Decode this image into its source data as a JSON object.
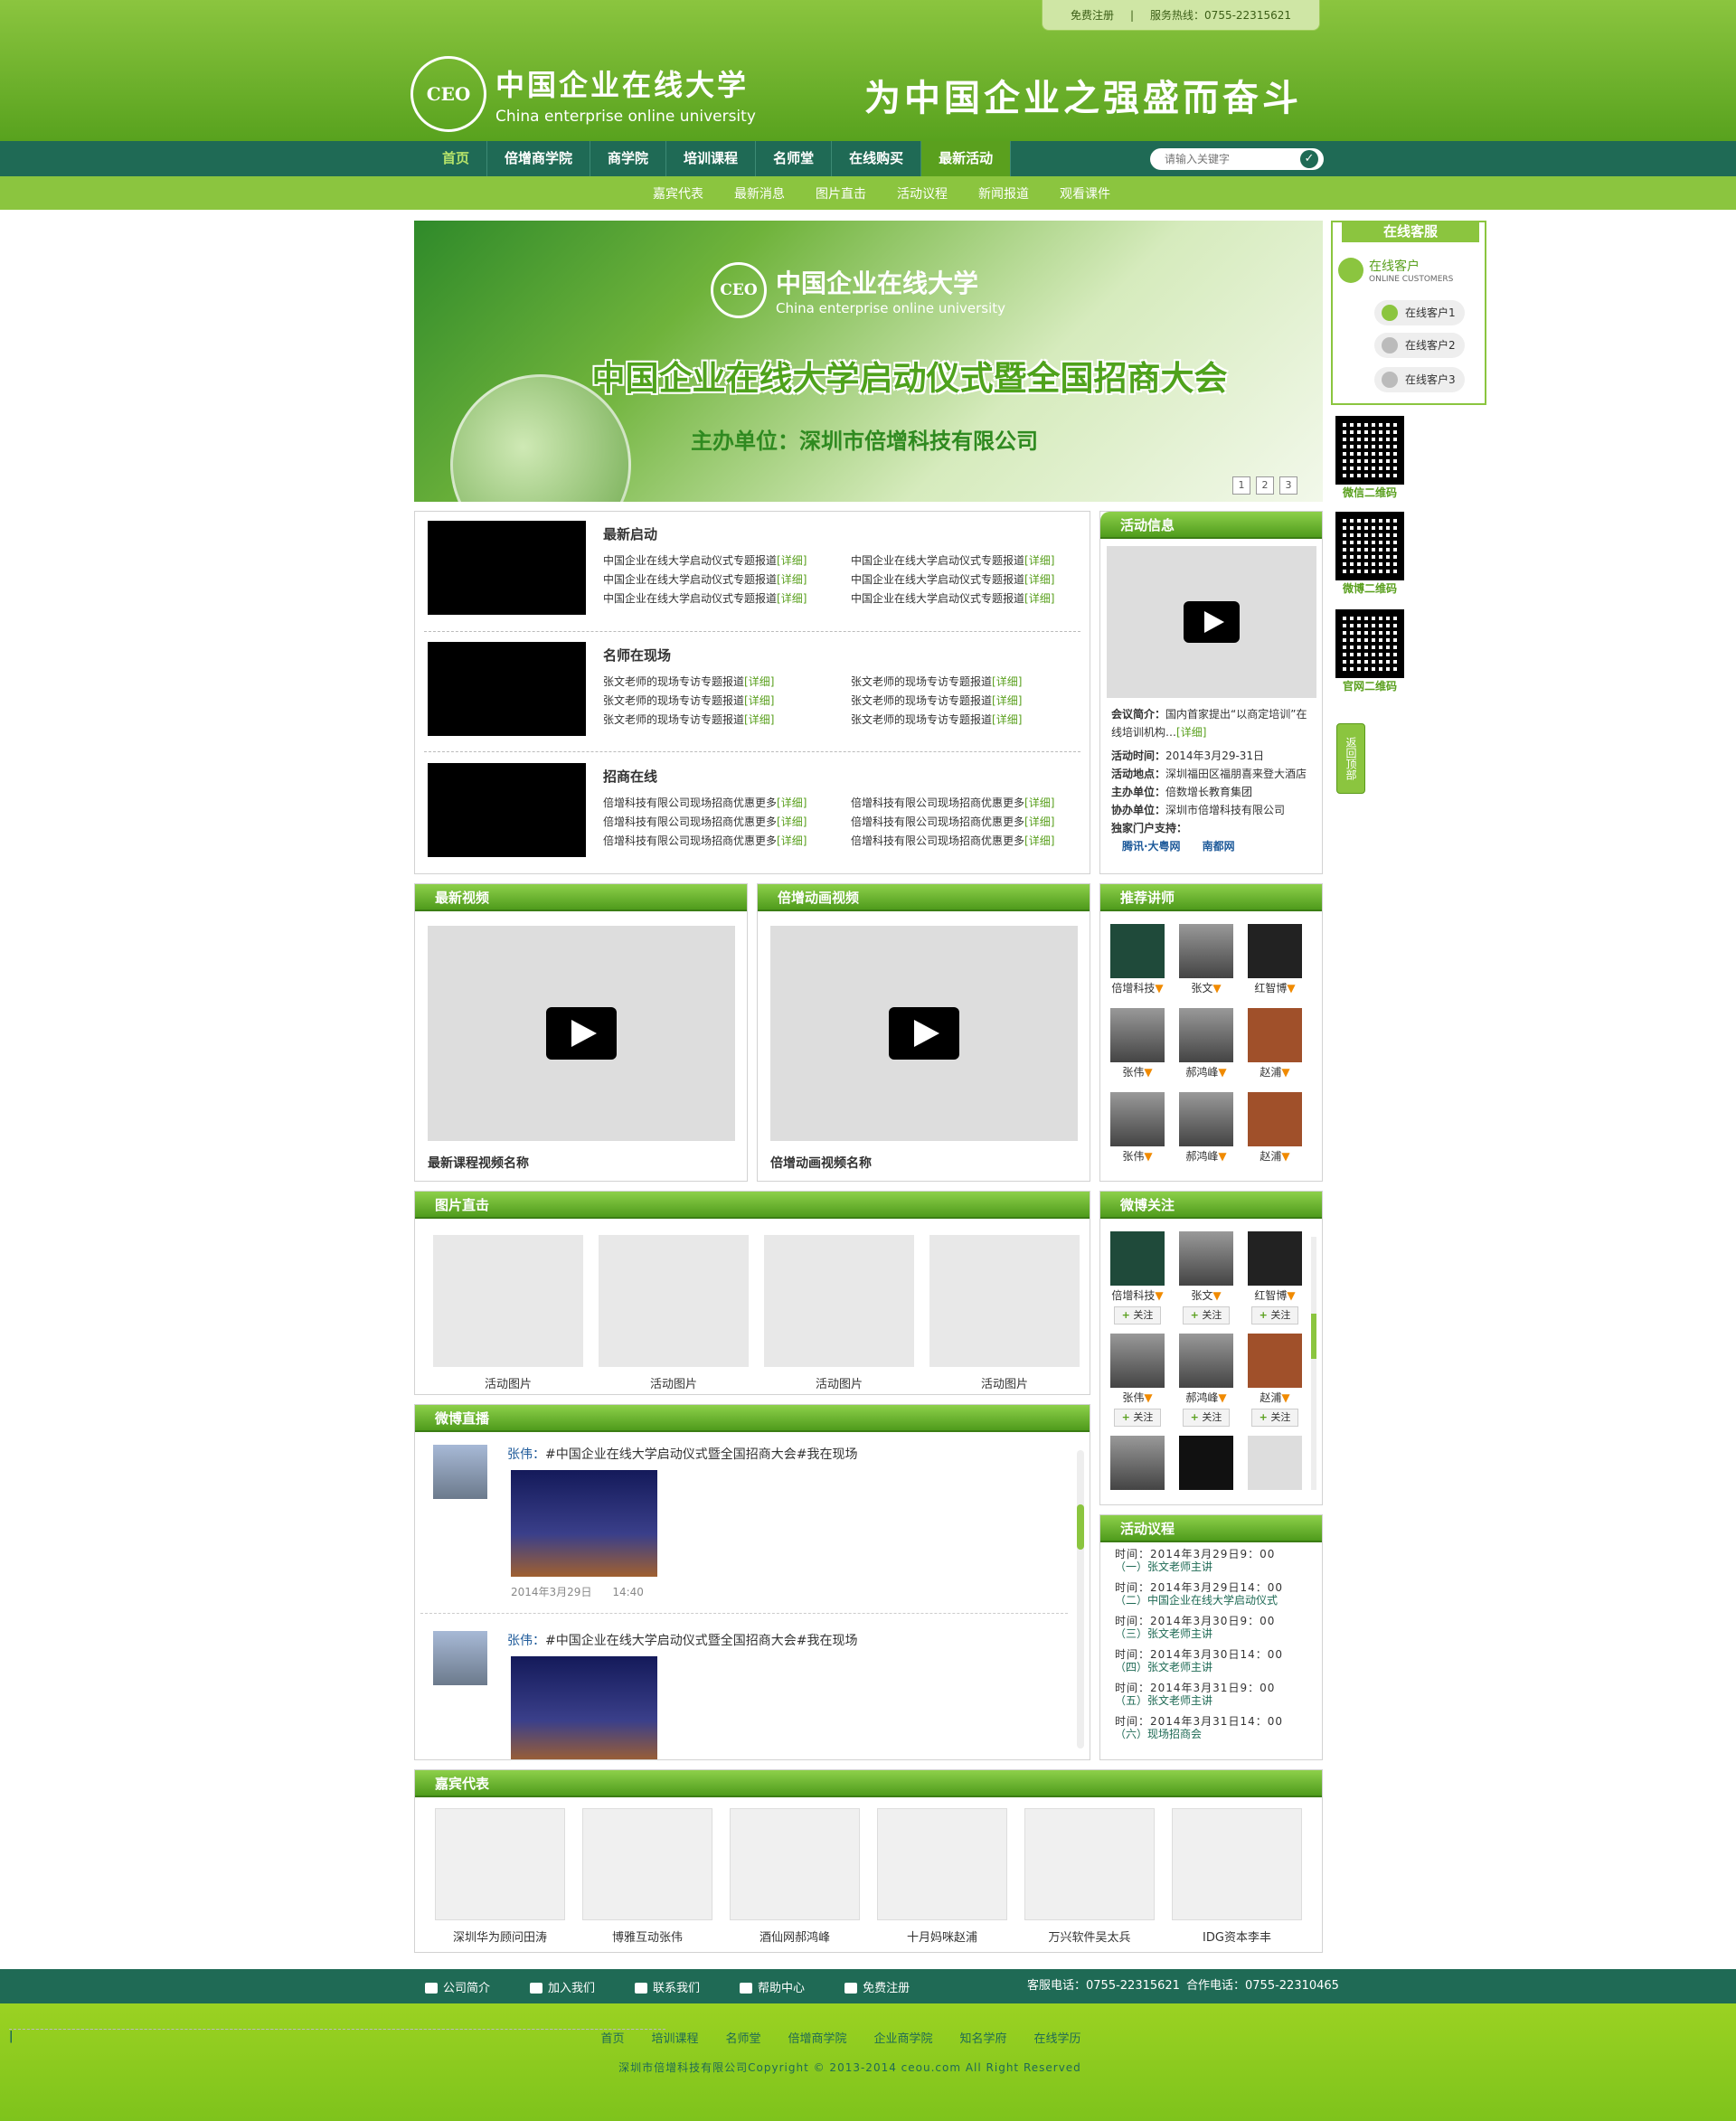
{
  "topbar": {
    "register": "免费注册",
    "hotline": "服务热线：0755-22315621"
  },
  "logo": {
    "badge": "CEO",
    "cn": "中国企业在线大学",
    "en": "China enterprise online university"
  },
  "slogan": "为中国企业之强盛而奋斗",
  "nav": {
    "items": [
      "首页",
      "倍增商学院",
      "商学院",
      "培训课程",
      "名师堂",
      "在线购买",
      "最新活动"
    ],
    "search_placeholder": "请输入关键字"
  },
  "subnav": [
    "嘉宾代表",
    "最新消息",
    "图片直击",
    "活动议程",
    "新闻报道",
    "观看课件"
  ],
  "banner": {
    "badge": "CEO",
    "cn": "中国企业在线大学",
    "en": "China enterprise online university",
    "title": "中国企业在线大学启动仪式暨全国招商大会",
    "sub": "主办单位：深圳市倍增科技有限公司",
    "pages": [
      "1",
      "2",
      "3"
    ]
  },
  "news": {
    "rows": [
      {
        "title": "最新启动",
        "item": "中国企业在线大学启动仪式专题报道",
        "more": "[详细]"
      },
      {
        "title": "名师在现场",
        "item": "张文老师的现场专访专题报道",
        "more": "[详细]"
      },
      {
        "title": "招商在线",
        "item": "倍增科技有限公司现场招商优惠更多",
        "more": "[详细]"
      }
    ]
  },
  "events": {
    "header": "活动信息",
    "intro_label": "会议简介：",
    "intro": "国内首家提出“以商定培训”在线培训机构…",
    "intro_more": "[详细]",
    "time_label": "活动时间：",
    "time": "2014年3月29-31日",
    "place_label": "活动地点：",
    "place": "深圳福田区福朋喜来登大酒店",
    "host_label": "主办单位：",
    "host": "倍数增长教育集团",
    "co_label": "协办单位：",
    "co": "深圳市倍增科技有限公司",
    "portal_label": "独家门户支持：",
    "portal1": "腾讯·大粤网",
    "portal2": "南都网"
  },
  "videos": [
    {
      "header": "最新视频",
      "caption": "最新课程视频名称"
    },
    {
      "header": "倍增动画视频",
      "caption": "倍增动画视频名称"
    }
  ],
  "teachers": {
    "header": "推荐讲师",
    "list": [
      [
        "倍增科技",
        "张文",
        "红智博"
      ],
      [
        "张伟",
        "郝鸿峰",
        "赵浦"
      ],
      [
        "张伟",
        "郝鸿峰",
        "赵浦"
      ]
    ]
  },
  "pics": {
    "header": "图片直击",
    "items": [
      "活动图片",
      "活动图片",
      "活动图片",
      "活动图片"
    ]
  },
  "weibo_follow": {
    "header": "微博关注",
    "follow": "关注",
    "list": [
      [
        "倍增科技",
        "张文",
        "红智博"
      ],
      [
        "张伟",
        "郝鸿峰",
        "赵浦"
      ]
    ]
  },
  "weibo": {
    "header": "微博直播",
    "posts": [
      {
        "user": "张伟：",
        "text": "#中国企业在线大学启动仪式暨全国招商大会#我在现场",
        "date": "2014年3月29日",
        "time": "14:40"
      },
      {
        "user": "张伟：",
        "text": "#中国企业在线大学启动仪式暨全国招商大会#我在现场"
      }
    ]
  },
  "agenda": {
    "header": "活动议程",
    "items": [
      {
        "t": "时间：2014年3月29日9：00",
        "s": "（一）张文老师主讲"
      },
      {
        "t": "时间：2014年3月29日14：00",
        "s": "（二）中国企业在线大学启动仪式"
      },
      {
        "t": "时间：2014年3月30日9：00",
        "s": "（三）张文老师主讲"
      },
      {
        "t": "时间：2014年3月30日14：00",
        "s": "（四）张文老师主讲"
      },
      {
        "t": "时间：2014年3月31日9：00",
        "s": "（五）张文老师主讲"
      },
      {
        "t": "时间：2014年3月31日14：00",
        "s": "（六）现场招商会"
      }
    ]
  },
  "guests": {
    "header": "嘉宾代表",
    "items": [
      "深圳华为顾问田涛",
      "博雅互动张伟",
      "酒仙网郝鸿峰",
      "十月妈咪赵浦",
      "万兴软件吴太兵",
      "IDG资本李丰"
    ]
  },
  "service": {
    "header": "在线客服",
    "title": "在线客户",
    "sub": "ONLINE CUSTOMERS",
    "items": [
      "在线客户1",
      "在线客户2",
      "在线客户3"
    ]
  },
  "qr": [
    "微信二维码",
    "微博二维码",
    "官网二维码"
  ],
  "backtop": "返回顶部",
  "footer": {
    "links": [
      "公司简介",
      "加入我们",
      "联系我们",
      "帮助中心",
      "免费注册"
    ],
    "service_tel": "客服电话：0755-22315621",
    "coop_tel": "合作电话：0755-22310465",
    "nav": [
      "首页",
      "培训课程",
      "名师堂",
      "倍增商学院",
      "企业商学院",
      "知名学府",
      "在线学历"
    ],
    "copy": "深圳市倍增科技有限公司Copyright © 2013-2014 ceou.com All Right Reserved"
  }
}
